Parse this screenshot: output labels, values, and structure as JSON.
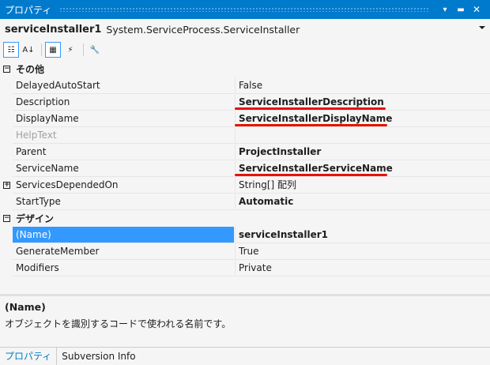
{
  "window": {
    "title": "プロパティ",
    "pin_glyph": "▾",
    "autohide_glyph": "▬",
    "close_glyph": "✕"
  },
  "object_selector": {
    "name": "serviceInstaller1",
    "type": "System.ServiceProcess.ServiceInstaller"
  },
  "toolbar": {
    "buttons": [
      {
        "icon": "categorized-icon",
        "glyph": "☷",
        "active": true
      },
      {
        "icon": "alphabetical-icon",
        "glyph": "A↓",
        "active": false
      },
      {
        "icon": "properties-icon",
        "glyph": "▦",
        "active": true
      },
      {
        "icon": "events-icon",
        "glyph": "⚡",
        "active": false
      },
      {
        "icon": "property-pages-icon",
        "glyph": "🔧",
        "active": false
      }
    ]
  },
  "categories": [
    {
      "name": "その他",
      "rows": [
        {
          "name": "DelayedAutoStart",
          "value": "False",
          "bold": false
        },
        {
          "name": "Description",
          "value": "ServiceInstallerDescription",
          "bold": true,
          "underline": true
        },
        {
          "name": "DisplayName",
          "value": "ServiceInstallerDisplayName",
          "bold": true,
          "underline": true
        },
        {
          "name": "HelpText",
          "value": "",
          "bold": false,
          "dim": true
        },
        {
          "name": "Parent",
          "value": "ProjectInstaller",
          "bold": true
        },
        {
          "name": "ServiceName",
          "value": "ServiceInstallerServiceName",
          "bold": true,
          "underline": true
        },
        {
          "name": "ServicesDependedOn",
          "value": "String[] 配列",
          "bold": false,
          "expandable": true
        },
        {
          "name": "StartType",
          "value": "Automatic",
          "bold": true
        }
      ]
    },
    {
      "name": "デザイン",
      "rows": [
        {
          "name": "(Name)",
          "value": "serviceInstaller1",
          "bold": true,
          "selected": true
        },
        {
          "name": "GenerateMember",
          "value": "True",
          "bold": false
        },
        {
          "name": "Modifiers",
          "value": "Private",
          "bold": false
        }
      ]
    }
  ],
  "description_panel": {
    "title": "(Name)",
    "text": "オブジェクトを識別するコードで使われる名前です。"
  },
  "tabs": [
    {
      "label": "プロパティ",
      "active": true
    },
    {
      "label": "Subversion Info",
      "active": false
    }
  ],
  "colors": {
    "accent": "#007acc",
    "selection": "#3399ff",
    "highlight_underline": "#e51400"
  }
}
